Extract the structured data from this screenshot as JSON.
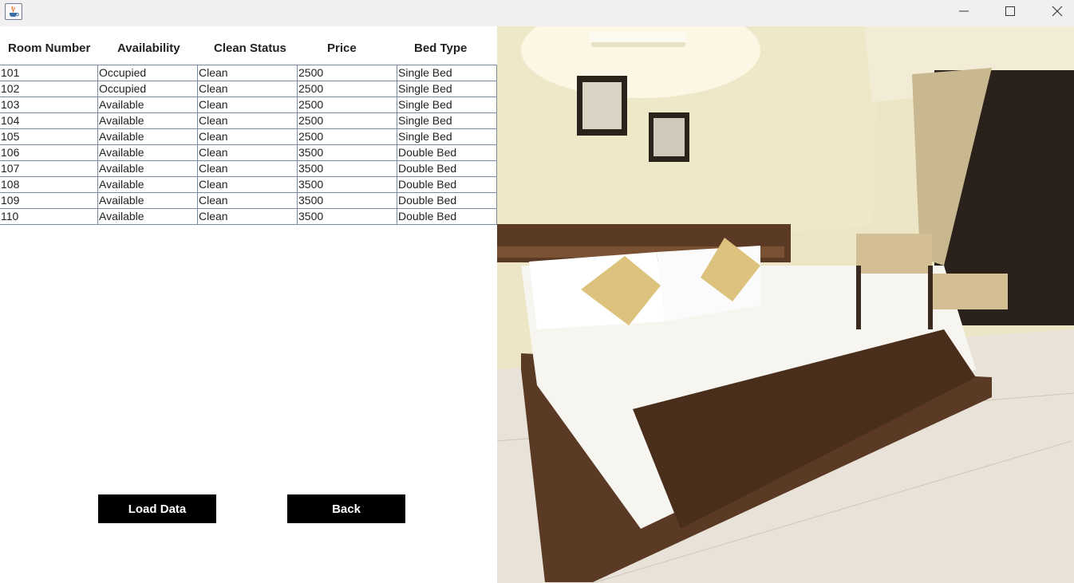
{
  "window": {
    "icon": "java-cup-icon",
    "controls": [
      "minimize-icon",
      "maximize-icon",
      "close-icon"
    ]
  },
  "table": {
    "headers": [
      "Room Number",
      "Availability",
      "Clean Status",
      "Price",
      "Bed Type"
    ],
    "rows": [
      [
        "101",
        "Occupied",
        "Clean",
        "2500",
        "Single Bed"
      ],
      [
        "102",
        "Occupied",
        "Clean",
        "2500",
        "Single Bed"
      ],
      [
        "103",
        "Available",
        "Clean",
        "2500",
        "Single Bed"
      ],
      [
        "104",
        "Available",
        "Clean",
        "2500",
        "Single Bed"
      ],
      [
        "105",
        "Available",
        "Clean",
        "2500",
        "Single Bed"
      ],
      [
        "106",
        "Available",
        "Clean",
        "3500",
        "Double Bed"
      ],
      [
        "107",
        "Available",
        "Clean",
        "3500",
        "Double Bed"
      ],
      [
        "108",
        "Available",
        "Clean",
        "3500",
        "Double Bed"
      ],
      [
        "109",
        "Available",
        "Clean",
        "3500",
        "Double Bed"
      ],
      [
        "110",
        "Available",
        "Clean",
        "3500",
        "Double Bed"
      ]
    ]
  },
  "buttons": {
    "load": "Load Data",
    "back": "Back"
  },
  "colors": {
    "button_bg": "#000000",
    "button_text": "#ffffff",
    "grid_line": "#7a8aa3",
    "titlebar": "#f0f0f0"
  }
}
